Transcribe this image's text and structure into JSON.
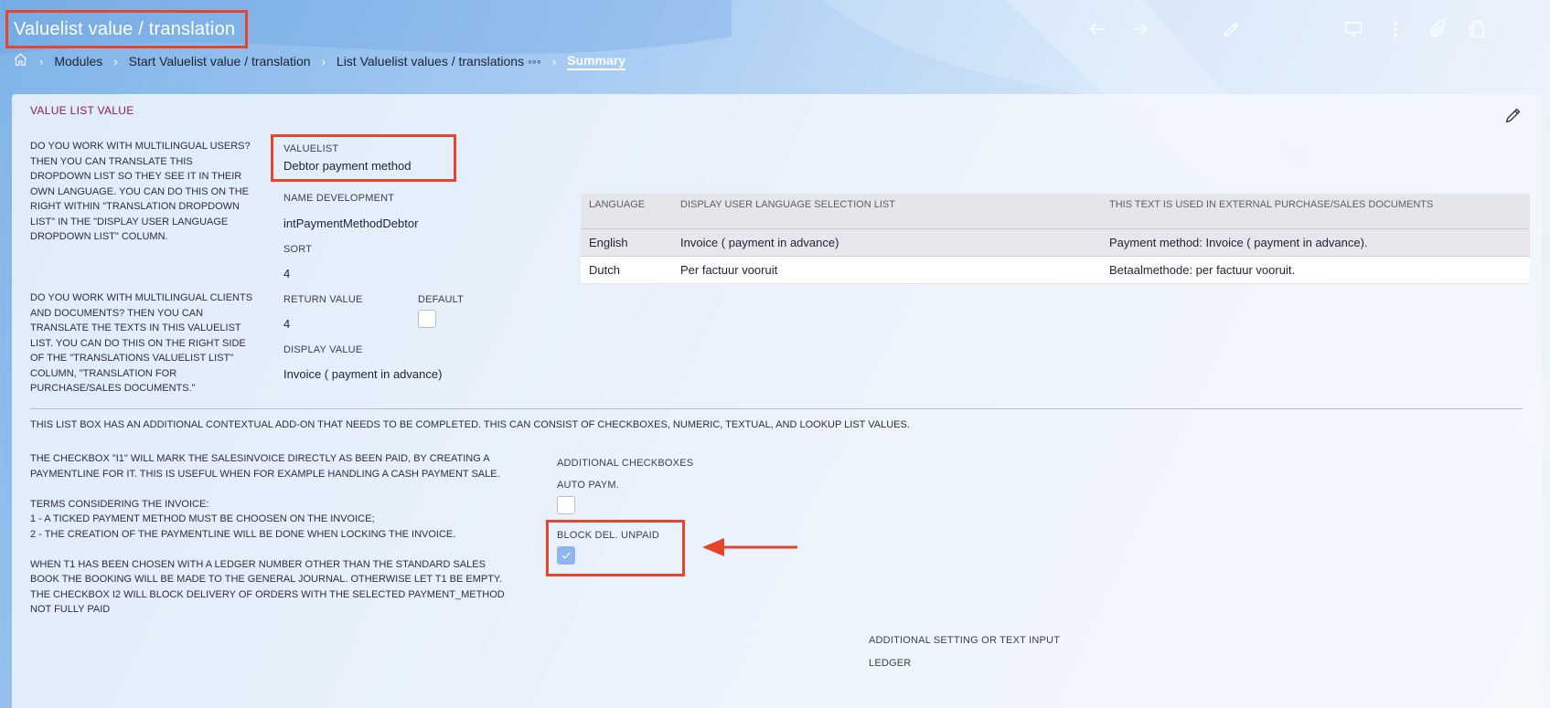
{
  "header": {
    "title": "Valuelist value / translation",
    "icons": [
      "arrow-left-icon",
      "arrow-right-icon",
      "pencil-icon",
      "monitor-icon",
      "more-vertical-icon",
      "paperclip-icon",
      "document-swap-icon"
    ]
  },
  "breadcrumb": {
    "items": [
      "Modules",
      "Start Valuelist value / translation",
      "List Valuelist values / translations ◦◦◦"
    ],
    "current": "Summary"
  },
  "panel": {
    "title": "VALUE LIST VALUE",
    "help_multilingual_users": "DO YOU WORK WITH MULTILINGUAL USERS?\nTHEN YOU CAN TRANSLATE THIS\nDROPDOWN LIST SO THEY SEE IT IN THEIR\nOWN LANGUAGE. YOU CAN DO THIS ON THE\nRIGHT WITHIN \"TRANSLATION DROPDOWN\nLIST\" IN THE \"DISPLAY USER LANGUAGE\nDROPDOWN LIST\" COLUMN.",
    "help_multilingual_clients": "DO YOU WORK WITH MULTILINGUAL CLIENTS\nAND DOCUMENTS? THEN YOU CAN\nTRANSLATE THE TEXTS IN THIS VALUELIST\nLIST. YOU CAN DO THIS ON THE RIGHT SIDE\nOF THE \"TRANSLATIONS VALUELIST LIST\"\nCOLUMN, \"TRANSLATION FOR\nPURCHASE/SALES DOCUMENTS.\"",
    "fields": {
      "valuelist_label": "VALUELIST",
      "valuelist_value": "Debtor payment method",
      "name_dev_label": "NAME DEVELOPMENT",
      "name_dev_value": "intPaymentMethodDebtor",
      "sort_label": "SORT",
      "sort_value": "4",
      "return_label": "RETURN VALUE",
      "return_value": "4",
      "default_label": "DEFAULT",
      "default_checked": false,
      "display_label": "DISPLAY VALUE",
      "display_value": "Invoice ( payment in advance)"
    }
  },
  "translations": {
    "headers": [
      "LANGUAGE",
      "DISPLAY USER LANGUAGE SELECTION LIST",
      "THIS TEXT IS USED IN EXTERNAL PURCHASE/SALES DOCUMENTS"
    ],
    "rows": [
      [
        "English",
        "Invoice ( payment in advance)",
        "Payment method: Invoice ( payment in advance)."
      ],
      [
        "Dutch",
        "Per factuur vooruit",
        "Betaalmethode: per factuur vooruit."
      ]
    ]
  },
  "addon": {
    "intro": "THIS LIST BOX HAS AN ADDITIONAL CONTEXTUAL ADD-ON THAT NEEDS TO BE COMPLETED. THIS CAN CONSIST OF CHECKBOXES, NUMERIC, TEXTUAL, AND LOOKUP LIST VALUES.",
    "help": "THE CHECKBOX \"I1\" WILL MARK THE SALESINVOICE DIRECTLY AS BEEN PAID, BY CREATING A\nPAYMENTLINE FOR IT. THIS IS USEFUL WHEN FOR EXAMPLE HANDLING A CASH PAYMENT SALE.\n\nTERMS CONSIDERING THE INVOICE:\n1 - A TICKED PAYMENT METHOD MUST BE CHOOSEN ON THE INVOICE;\n2 - THE CREATION OF THE PAYMENTLINE WILL BE DONE WHEN LOCKING THE INVOICE.\n\nWHEN T1 HAS BEEN CHOSEN WITH A LEDGER NUMBER OTHER THAN THE STANDARD SALES\nBOOK THE BOOKING WILL BE MADE TO THE GENERAL JOURNAL. OTHERWISE LET T1 BE EMPTY.\nTHE CHECKBOX I2 WILL BLOCK DELIVERY OF ORDERS WITH THE SELECTED PAYMENT_METHOD\nNOT FULLY PAID",
    "checkboxes_label": "ADDITIONAL CHECKBOXES",
    "auto_paym_label": "AUTO PAYM.",
    "auto_paym_checked": false,
    "block_del_label": "BLOCK DEL. UNPAID",
    "block_del_checked": true,
    "setting_label": "ADDITIONAL SETTING OR TEXT INPUT",
    "ledger_label": "LEDGER"
  },
  "colors": {
    "highlight": "#e8442a",
    "panel_title": "#8e1c4e",
    "checkbox_checked": "#8cb6ec"
  }
}
